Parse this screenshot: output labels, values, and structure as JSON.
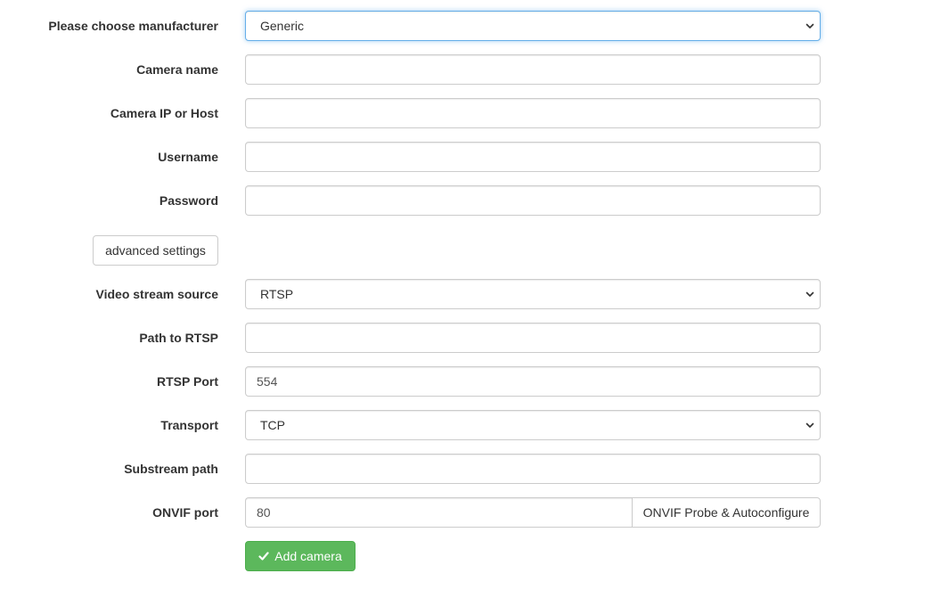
{
  "form": {
    "manufacturer": {
      "label": "Please choose manufacturer",
      "value": "Generic"
    },
    "camera_name": {
      "label": "Camera name",
      "value": ""
    },
    "camera_host": {
      "label": "Camera IP or Host",
      "value": ""
    },
    "username": {
      "label": "Username",
      "value": ""
    },
    "password": {
      "label": "Password",
      "value": ""
    },
    "advanced_settings_label": "advanced settings",
    "video_source": {
      "label": "Video stream source",
      "value": "RTSP"
    },
    "rtsp_path": {
      "label": "Path to RTSP",
      "value": ""
    },
    "rtsp_port": {
      "label": "RTSP Port",
      "value": "554"
    },
    "transport": {
      "label": "Transport",
      "value": "TCP"
    },
    "substream_path": {
      "label": "Substream path",
      "value": ""
    },
    "onvif_port": {
      "label": "ONVIF port",
      "value": "80"
    },
    "onvif_probe_label": "ONVIF Probe & Autoconfigure",
    "add_camera_label": "Add camera"
  },
  "colors": {
    "success": "#5cb85c",
    "focus": "#66afe9",
    "border": "#cccccc"
  },
  "icons": {
    "select_arrow": "chevron-down-icon",
    "add_camera": "check-icon"
  }
}
